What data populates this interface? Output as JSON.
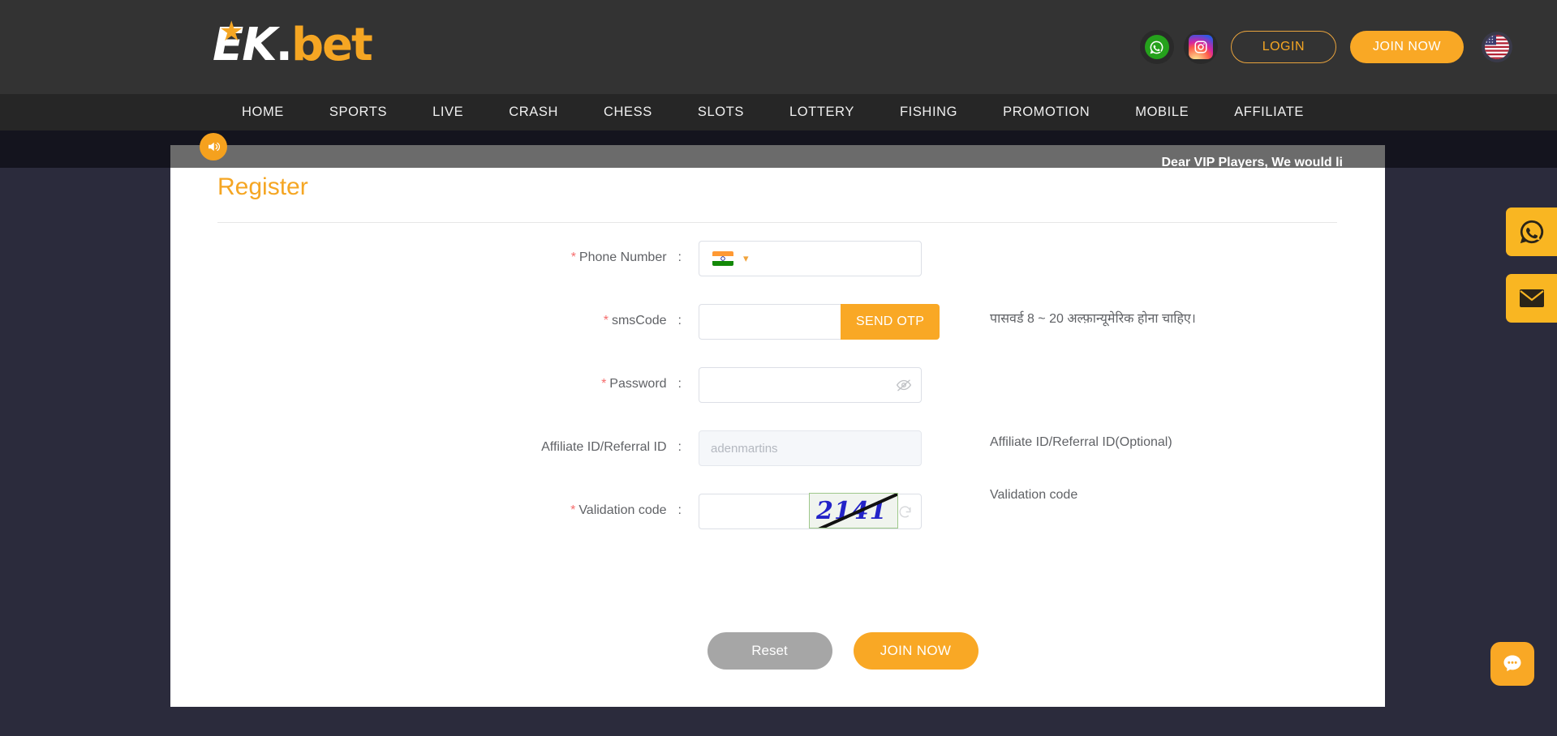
{
  "header": {
    "logo": {
      "star_icon": "star-icon",
      "text_primary": "EK",
      "text_dot": ".",
      "text_accent": "bet"
    },
    "social": [
      {
        "name": "whatsapp",
        "icon": "whatsapp-icon"
      },
      {
        "name": "instagram",
        "icon": "instagram-icon"
      }
    ],
    "login_label": "LOGIN",
    "join_label": "JOIN NOW",
    "language_flag": "us-flag-icon"
  },
  "nav": {
    "items": [
      {
        "label": "HOME"
      },
      {
        "label": "SPORTS"
      },
      {
        "label": "LIVE"
      },
      {
        "label": "CRASH"
      },
      {
        "label": "CHESS"
      },
      {
        "label": "SLOTS"
      },
      {
        "label": "LOTTERY"
      },
      {
        "label": "FISHING"
      },
      {
        "label": "PROMOTION"
      },
      {
        "label": "MOBILE"
      },
      {
        "label": "AFFILIATE"
      }
    ]
  },
  "announcement": {
    "speaker_icon": "speaker-icon",
    "text": "Dear VIP Players, We would li"
  },
  "register": {
    "title": "Register",
    "fields": {
      "phone": {
        "label": "Phone Number",
        "required_mark": "*",
        "colon": ":",
        "country_flag": "india-flag-icon",
        "chevron": "chevron-down-icon",
        "value": "",
        "placeholder": ""
      },
      "sms": {
        "label": "smsCode",
        "required_mark": "*",
        "colon": ":",
        "value": "",
        "placeholder": "",
        "send_otp_label": "SEND OTP"
      },
      "password": {
        "label": "Password",
        "required_mark": "*",
        "colon": ":",
        "value": "",
        "placeholder": "",
        "toggle_icon": "eye-off-icon",
        "hint": "पासवर्ड 8 ~ 20 अल्फ़ान्यूमेरिक होना चाहिए।"
      },
      "affiliate": {
        "label": "Affiliate ID/Referral ID",
        "required_mark": "",
        "colon": ":",
        "value": "adenmartins",
        "placeholder": "adenmartins",
        "hint": "Affiliate ID/Referral ID(Optional)"
      },
      "validation": {
        "label": "Validation code",
        "required_mark": "*",
        "colon": ":",
        "value": "",
        "placeholder": "",
        "captcha_text": "2141",
        "refresh_icon": "refresh-icon",
        "hint": "Validation code"
      }
    },
    "actions": {
      "reset_label": "Reset",
      "join_label": "JOIN NOW"
    }
  },
  "floating": {
    "whatsapp_icon": "whatsapp-icon",
    "mail_icon": "mail-icon",
    "chat_icon": "chat-bubble-icon"
  },
  "colors": {
    "accent": "#f9a825",
    "accent_text": "#f5a623",
    "header_bg": "#333333",
    "nav_bg": "#262626",
    "page_bg": "#2b2b3c",
    "announce_bg": "#6b6b6b",
    "required": "#f56c6c",
    "captcha_text": "#2323c8"
  }
}
